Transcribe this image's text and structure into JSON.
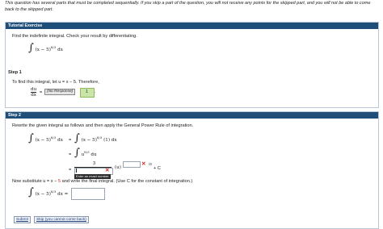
{
  "notice": "This question has several parts that must be completed sequentially. If you skip a part of the question, you will not receive any points for the skipped part, and you will not be able to come back to the skipped part.",
  "tutorial": {
    "header": "Tutorial Exercise",
    "prompt": "Find the indefinite integral. Check your result by differentiating.",
    "integrand": "(x − 5)",
    "exponent": "8/3",
    "dx": "dx"
  },
  "step1": {
    "label": "Step 1",
    "text": "To find this integral, let  u = x − 5.  Therefore,",
    "du": "du",
    "dx": "dx",
    "equals": "=",
    "response": "(No Response)",
    "green_value": "1",
    "after": "."
  },
  "step2": {
    "header": "Step 2",
    "text": "Rewrite the given integral as follows and then apply the General Power Rule of integration.",
    "line1_left": "(x − 5)",
    "line1_left_exp": "8/3",
    "line1_left_dx": "dx",
    "line1_eq": "=",
    "line1_right": "(x − 5)",
    "line1_right_exp": "8/3",
    "line1_right_tail": "(1) dx",
    "line2_eq": "=",
    "line2_u": "u",
    "line2_exp": "8/3",
    "line2_du": "du",
    "line3_eq": "=",
    "frac_num": "3",
    "paren_u": "(u)",
    "exp_after": "/3",
    "plus_c": "+ C",
    "tooltip": "Enter an exact number.",
    "subst_text_a": "Now substitute  u = x −",
    "subst_red": "5",
    "subst_text_b": "and write the final integral. (Use C for the constant of integration.)",
    "final_integrand": "(x − 5)",
    "final_exp": "8/3",
    "final_dx": "dx ="
  },
  "buttons": {
    "submit": "Submit",
    "skip": "Skip (you cannot come back)"
  },
  "colors": {
    "header_bg": "#1f4e79",
    "error_red": "#d8261c",
    "correct_green": "#c9e6a8"
  }
}
